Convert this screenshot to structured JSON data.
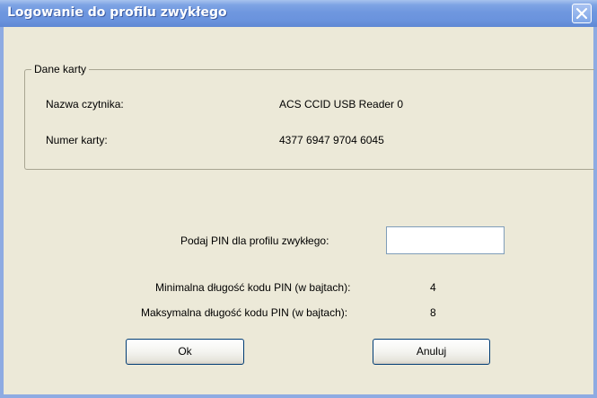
{
  "window": {
    "title": "Logowanie do profilu zwykłego",
    "accent_color": "#6f97df"
  },
  "card_info": {
    "group_label": "Dane karty",
    "reader_label": "Nazwa czytnika:",
    "reader_value": "ACS CCID USB Reader 0",
    "card_label": "Numer karty:",
    "card_value": "4377 6947 9704 6045"
  },
  "pin": {
    "prompt": "Podaj PIN dla profilu zwykłego:",
    "value": "",
    "placeholder": "",
    "min_label": "Minimalna długość kodu PIN (w bajtach):",
    "min_value": "4",
    "max_label": "Maksymalna długość kodu PIN (w bajtach):",
    "max_value": "8"
  },
  "buttons": {
    "ok_label": "Ok",
    "cancel_label": "Anuluj"
  },
  "icons": {
    "close": "close-icon"
  }
}
